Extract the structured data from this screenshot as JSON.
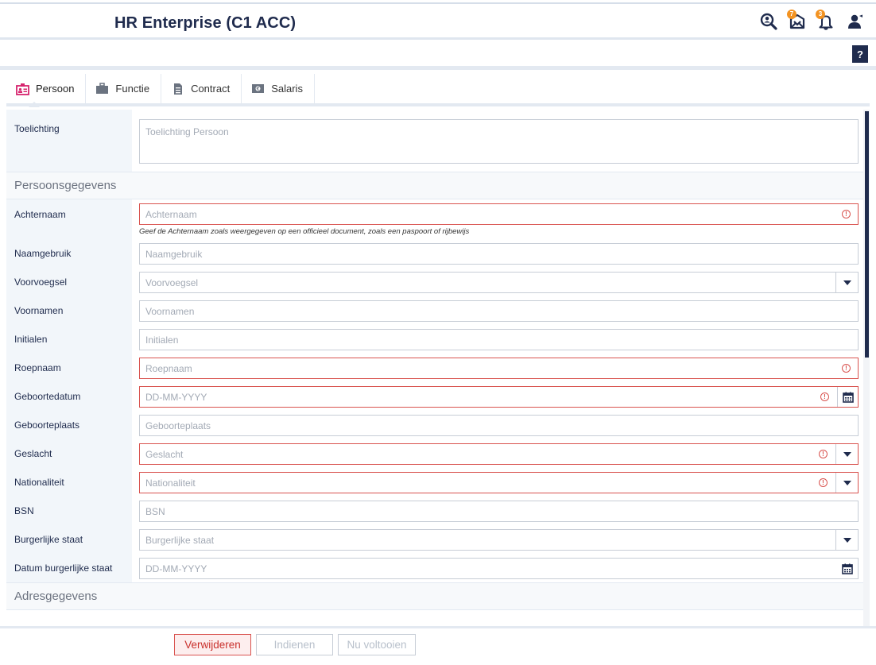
{
  "header": {
    "title": "HR Enterprise (C1 ACC)",
    "icons": [
      {
        "name": "search-person-icon"
      },
      {
        "name": "inbox-icon",
        "badge": "7"
      },
      {
        "name": "bell-icon",
        "badge": "3"
      },
      {
        "name": "user-icon"
      }
    ]
  },
  "help": {
    "label": "?"
  },
  "tabs": [
    {
      "label": "Persoon",
      "icon": "person-badge-icon",
      "active": true
    },
    {
      "label": "Functie",
      "icon": "briefcase-icon"
    },
    {
      "label": "Contract",
      "icon": "document-icon"
    },
    {
      "label": "Salaris",
      "icon": "money-icon"
    }
  ],
  "form": {
    "toelichting": {
      "label": "Toelichting",
      "placeholder": "Toelichting Persoon"
    },
    "section_persoon": "Persoonsgegevens",
    "achternaam": {
      "label": "Achternaam",
      "placeholder": "Achternaam",
      "hint": "Geef de Achternaam zoals weergegeven op een officieel document, zoals een paspoort of rijbewijs"
    },
    "naamgebruik": {
      "label": "Naamgebruik",
      "placeholder": "Naamgebruik"
    },
    "voorvoegsel": {
      "label": "Voorvoegsel",
      "placeholder": "Voorvoegsel"
    },
    "voornamen": {
      "label": "Voornamen",
      "placeholder": "Voornamen"
    },
    "initialen": {
      "label": "Initialen",
      "placeholder": "Initialen"
    },
    "roepnaam": {
      "label": "Roepnaam",
      "placeholder": "Roepnaam"
    },
    "geboortedatum": {
      "label": "Geboortedatum",
      "placeholder": "DD-MM-YYYY"
    },
    "geboorteplaats": {
      "label": "Geboorteplaats",
      "placeholder": "Geboorteplaats"
    },
    "geslacht": {
      "label": "Geslacht",
      "placeholder": "Geslacht"
    },
    "nationaliteit": {
      "label": "Nationaliteit",
      "placeholder": "Nationaliteit"
    },
    "bsn": {
      "label": "BSN",
      "placeholder": "BSN"
    },
    "burgerlijke_staat": {
      "label": "Burgerlijke staat",
      "placeholder": "Burgerlijke staat"
    },
    "datum_burgerlijke_staat": {
      "label": "Datum burgerlijke staat",
      "placeholder": "DD-MM-YYYY"
    },
    "section_adres": "Adresgegevens",
    "error_symbol": "!"
  },
  "footer": {
    "delete_label": "Verwijderen",
    "submit_label": "Indienen",
    "complete_label": "Nu voltooien"
  },
  "colors": {
    "brand_dark": "#1f2b4d",
    "error": "#d9534f",
    "badge": "#f39321",
    "tab_icon_pink": "#d6246e"
  }
}
